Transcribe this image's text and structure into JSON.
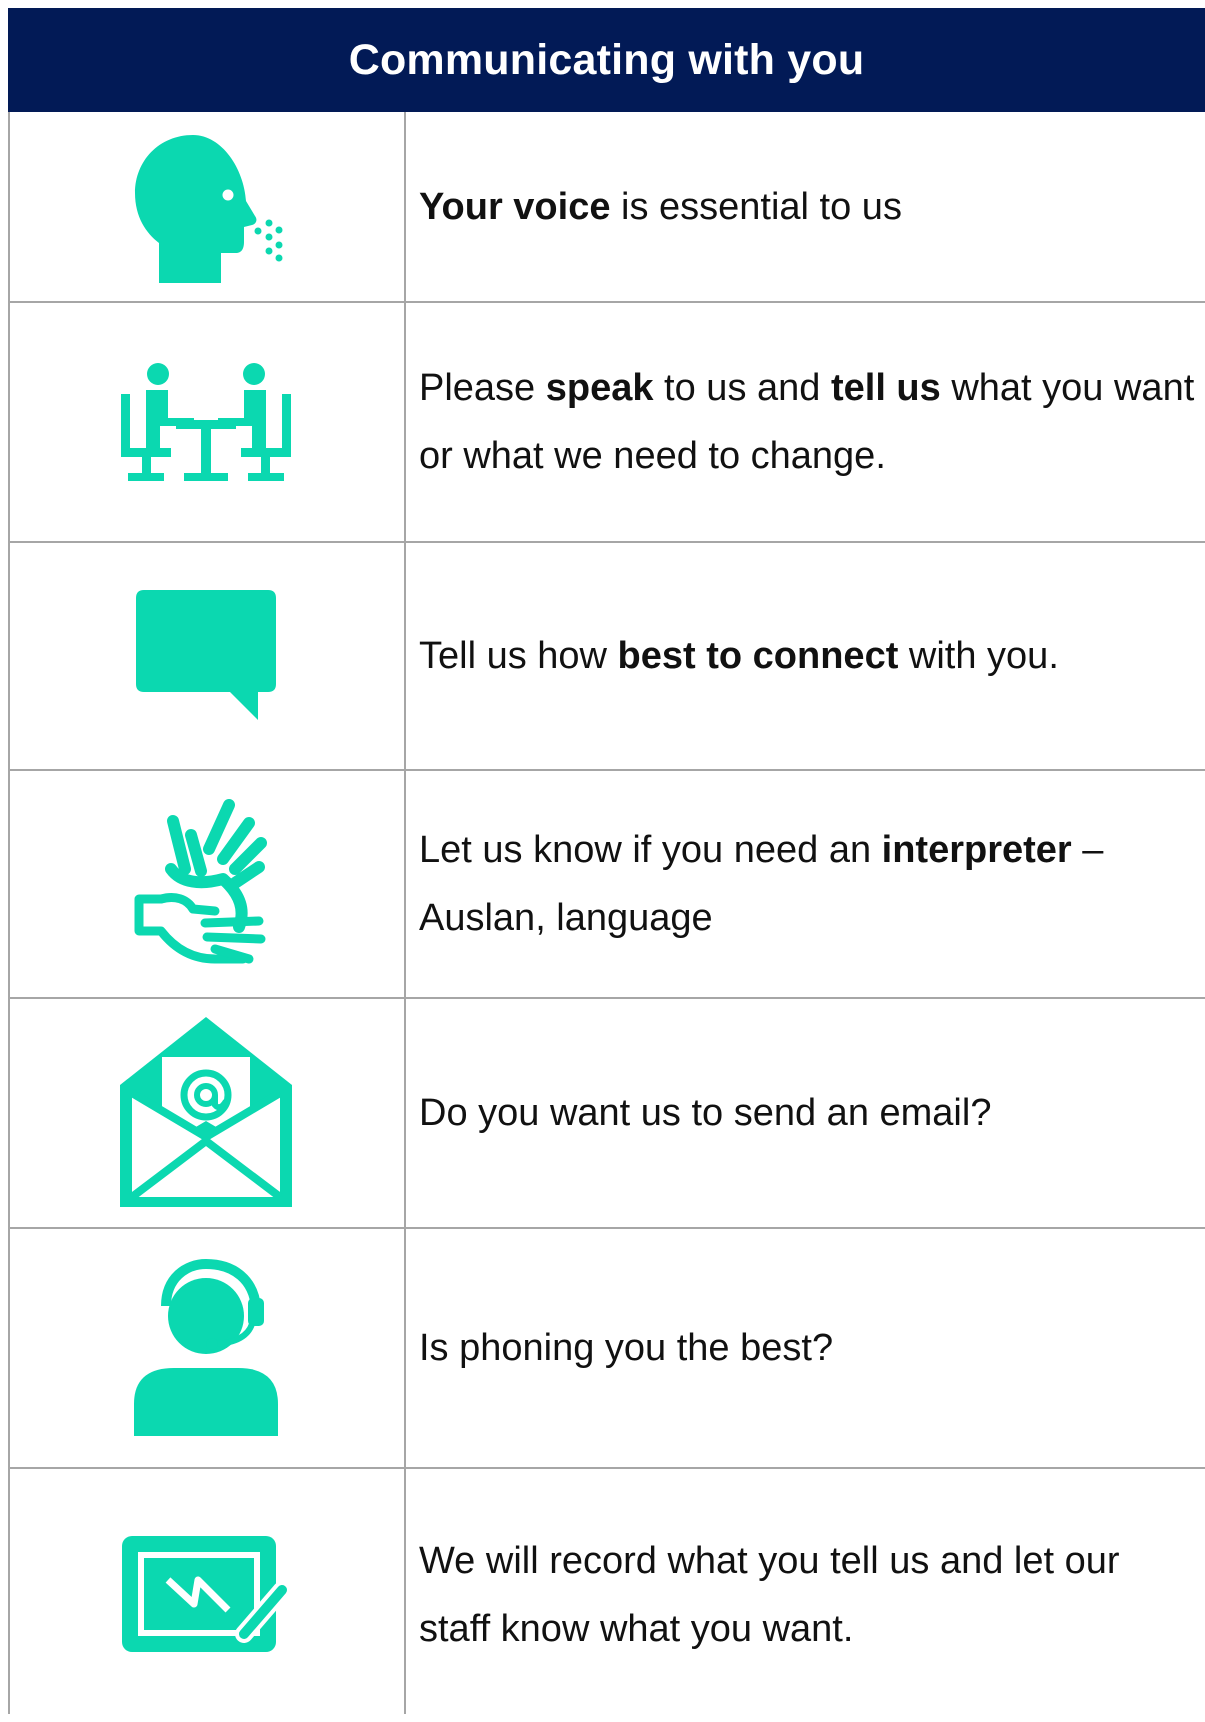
{
  "title": "Communicating with you",
  "colors": {
    "header_bg": "#021a56",
    "icon": "#0bd8b0",
    "text": "#111111",
    "border": "#a6a6a6"
  },
  "rows": [
    {
      "icon": "speaking-head-icon",
      "parts": [
        {
          "t": "Your voice",
          "b": true
        },
        {
          "t": " is essential to us"
        }
      ]
    },
    {
      "icon": "people-meeting-icon",
      "parts": [
        {
          "t": "Please "
        },
        {
          "t": "speak",
          "b": true
        },
        {
          "t": " to us and "
        },
        {
          "t": "tell us",
          "b": true
        },
        {
          "t": " what you want or what we need to change."
        }
      ]
    },
    {
      "icon": "speech-bubble-icon",
      "parts": [
        {
          "t": "Tell us how "
        },
        {
          "t": "best to connect",
          "b": true
        },
        {
          "t": " with you."
        }
      ]
    },
    {
      "icon": "sign-language-icon",
      "parts": [
        {
          "t": "Let us know if you need an "
        },
        {
          "t": "interpreter",
          "b": true
        },
        {
          "t": " – Auslan, language"
        }
      ]
    },
    {
      "icon": "email-envelope-icon",
      "parts": [
        {
          "t": "Do you want us to send an email?"
        }
      ]
    },
    {
      "icon": "headset-person-icon",
      "parts": [
        {
          "t": "Is phoning you the best?"
        }
      ]
    },
    {
      "icon": "tablet-stylus-icon",
      "parts": [
        {
          "t": "We will record what you tell us and let our staff know what you want."
        }
      ]
    }
  ]
}
